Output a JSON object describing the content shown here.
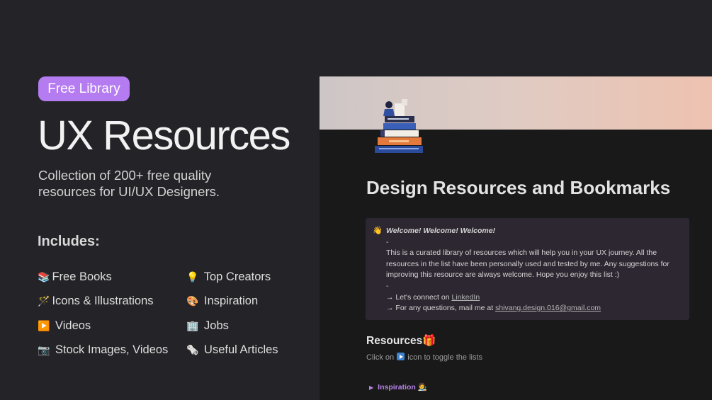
{
  "badge": {
    "label": "Free Library"
  },
  "hero": {
    "title": "UX Resources",
    "subtitle": "Collection of 200+ free quality resources for UI/UX Designers."
  },
  "includes": {
    "heading": "Includes:",
    "items": [
      {
        "icon": "📚",
        "icon_name": "books-icon",
        "label": "Free Books"
      },
      {
        "icon": "💡",
        "icon_name": "lightbulb-icon",
        "label": " Top Creators"
      },
      {
        "icon": "🪄",
        "icon_name": "magic-wand-icon",
        "label": "Icons & Illustrations"
      },
      {
        "icon": "🎨",
        "icon_name": "palette-icon",
        "label": " Inspiration"
      },
      {
        "icon": "▶️",
        "icon_name": "play-button-icon",
        "label": " Videos"
      },
      {
        "icon": "🏢",
        "icon_name": "office-building-icon",
        "label": " Jobs"
      },
      {
        "icon": "📷",
        "icon_name": "camera-icon",
        "label": " Stock Images, Videos"
      },
      {
        "icon": "🗞️",
        "icon_name": "newspaper-icon",
        "label": " Useful Articles"
      }
    ]
  },
  "preview": {
    "title": "Design Resources and Bookmarks",
    "callout": {
      "emoji": "👋",
      "welcome": "Welcome! Welcome! Welcome!",
      "dash1": "-",
      "body": "This is a curated library of resources which will help you in your UX journey. All the resources in the list have been personally used and tested by me. Any suggestions for improving this resource are always welcome. Hope you enjoy this list :)",
      "dash2": "-",
      "connect_prefix": "→ Let's connect on ",
      "connect_link": "LinkedIn",
      "mail_prefix": "→ For any questions, mail me at ",
      "mail_link": "shivang.design.016@gmail.com"
    },
    "resources": {
      "heading": "Resources",
      "heading_emoji": "🎁",
      "hint_prefix": "Click on ",
      "hint_suffix": " icon to toggle the lists",
      "toggle_label": "Inspiration",
      "toggle_emoji": "🧑‍🎨"
    }
  },
  "colors": {
    "background": "#242428",
    "badge": "#b57cf2",
    "preview_bg": "#191919",
    "callout_bg": "#2d2731",
    "toggle_accent": "#b583e6"
  }
}
